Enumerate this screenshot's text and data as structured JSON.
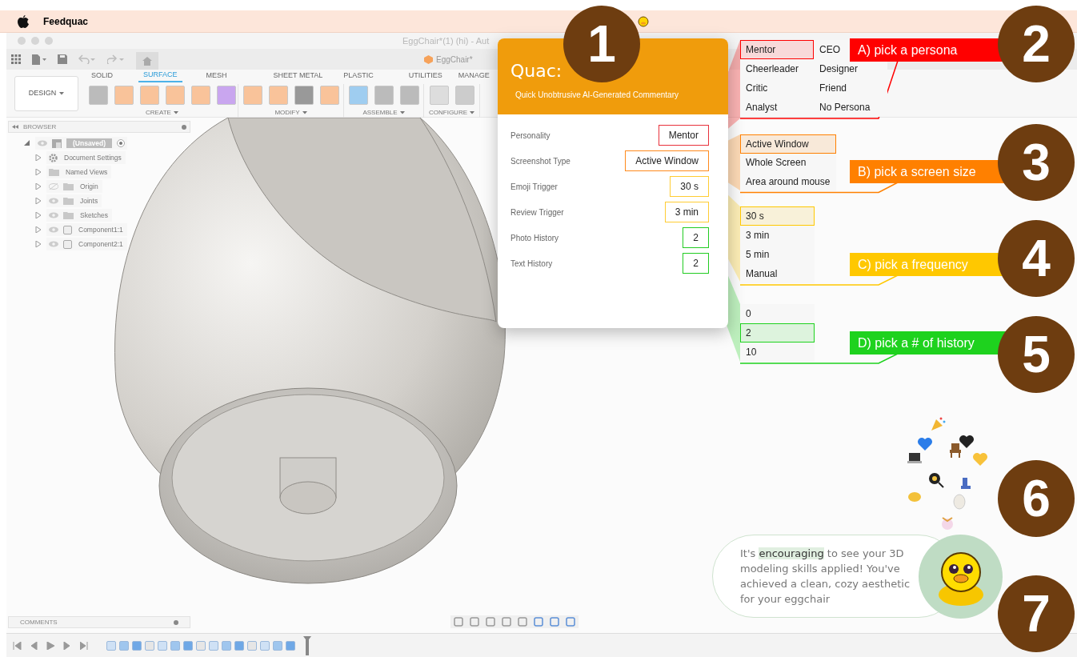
{
  "menu_bar": {
    "app_name": "Feedquac"
  },
  "window": {
    "title": "EggChair*(1) (hi) - Aut",
    "document_tab": "EggChair*"
  },
  "workspace_button": "DESIGN",
  "ribbon_tabs": [
    {
      "label": "SOLID",
      "selected": false
    },
    {
      "label": "SURFACE",
      "selected": true
    },
    {
      "label": "MESH",
      "selected": false
    },
    {
      "label": "SHEET METAL",
      "selected": false
    },
    {
      "label": "PLASTIC",
      "selected": false
    },
    {
      "label": "UTILITIES",
      "selected": false
    },
    {
      "label": "MANAGE",
      "selected": false
    }
  ],
  "ribbon_groups": [
    "CREATE",
    "MODIFY",
    "ASSEMBLE",
    "CONFIGURE"
  ],
  "browser": {
    "title": "BROWSER",
    "tree": [
      {
        "label": "(Unsaved)",
        "kind": "document",
        "visible": true,
        "expanded": true,
        "children": [
          {
            "label": "Document Settings",
            "kind": "settings",
            "expanded": false
          },
          {
            "label": "Named Views",
            "kind": "folder",
            "expanded": false
          },
          {
            "label": "Origin",
            "kind": "folder",
            "visible": false,
            "expanded": false
          },
          {
            "label": "Joints",
            "kind": "folder",
            "visible": true,
            "expanded": false
          },
          {
            "label": "Sketches",
            "kind": "folder",
            "visible": true,
            "expanded": false
          },
          {
            "label": "Component1:1",
            "kind": "component",
            "visible": true,
            "expanded": false
          },
          {
            "label": "Component2:1",
            "kind": "component",
            "visible": true,
            "expanded": false
          }
        ]
      }
    ]
  },
  "comments": {
    "title": "COMMENTS"
  },
  "quac_panel": {
    "logo": "Quac:",
    "subtitle": "Quick Unobtrusive AI-Generated Commentary",
    "settings": [
      {
        "label": "Personality",
        "value": "Mentor",
        "color": "#e8323c"
      },
      {
        "label": "Screenshot Type",
        "value": "Active Window",
        "color": "#ff8a1c"
      },
      {
        "label": "Emoji Trigger",
        "value": "30 s",
        "color": "#ffcc33"
      },
      {
        "label": "Review Trigger",
        "value": "3 min",
        "color": "#ffcc33"
      },
      {
        "label": "Photo History",
        "value": "2",
        "color": "#22cc22"
      },
      {
        "label": "Text History",
        "value": "2",
        "color": "#22cc22"
      }
    ]
  },
  "option_groups": [
    {
      "callout": "A) pick a persona",
      "color": "#ff0000",
      "options": [
        {
          "label": "Mentor",
          "selected": true
        },
        {
          "label": "CEO",
          "selected": false
        },
        {
          "label": "Cheerleader",
          "selected": false
        },
        {
          "label": "Designer",
          "selected": false
        },
        {
          "label": "Critic",
          "selected": false
        },
        {
          "label": "Friend",
          "selected": false
        },
        {
          "label": "Analyst",
          "selected": false
        },
        {
          "label": "No Persona",
          "selected": false
        }
      ]
    },
    {
      "callout": "B)  pick a screen size",
      "color": "#ff8000",
      "options": [
        {
          "label": "Active Window",
          "selected": true
        },
        {
          "label": "Whole Screen",
          "selected": false
        },
        {
          "label": "Area around mouse",
          "selected": false
        }
      ]
    },
    {
      "callout": "C)  pick a frequency",
      "color": "#ffc800",
      "options": [
        {
          "label": "30 s",
          "selected": true
        },
        {
          "label": "3 min",
          "selected": false
        },
        {
          "label": "5 min",
          "selected": false
        },
        {
          "label": "Manual",
          "selected": false
        }
      ]
    },
    {
      "callout": "D)  pick a # of history",
      "color": "#1ed21e",
      "options": [
        {
          "label": "0",
          "selected": false
        },
        {
          "label": "2",
          "selected": true
        },
        {
          "label": "10",
          "selected": false
        }
      ]
    }
  ],
  "step_badges": [
    "1",
    "2",
    "3",
    "4",
    "5",
    "6",
    "7"
  ],
  "commentary": {
    "before": "It's ",
    "highlight": "encouraging",
    "after": " to see your 3D modeling skills applied! You've achieved a clean, cozy aesthetic for your eggchair"
  }
}
